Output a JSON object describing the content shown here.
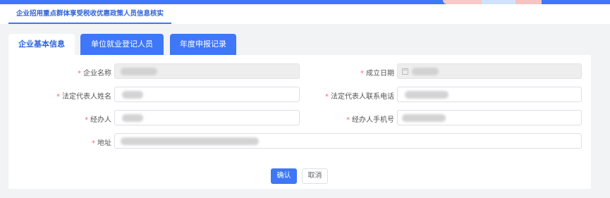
{
  "header": {
    "breadcrumb_label": "企业招用重点群体享受税收优惠政策人员信息核实"
  },
  "tabs": [
    {
      "label": "企业基本信息",
      "active": true
    },
    {
      "label": "单位就业登记人员",
      "active": false
    },
    {
      "label": "年度申报记录",
      "active": false
    }
  ],
  "form": {
    "required_mark": "*",
    "fields": {
      "company_name": {
        "label": "企业名称",
        "disabled": true
      },
      "established_date": {
        "label": "成立日期",
        "disabled": true,
        "icon": "calendar-icon"
      },
      "legal_rep_name": {
        "label": "法定代表人姓名"
      },
      "legal_rep_phone": {
        "label": "法定代表人联系电话"
      },
      "handler": {
        "label": "经办人"
      },
      "handler_mobile": {
        "label": "经办人手机号"
      },
      "address": {
        "label": "地址"
      }
    }
  },
  "actions": {
    "confirm_label": "确认",
    "cancel_label": "取消"
  },
  "colors": {
    "primary": "#3e77f7",
    "required": "#f56c6c",
    "page_bg": "#f2f3f5"
  }
}
